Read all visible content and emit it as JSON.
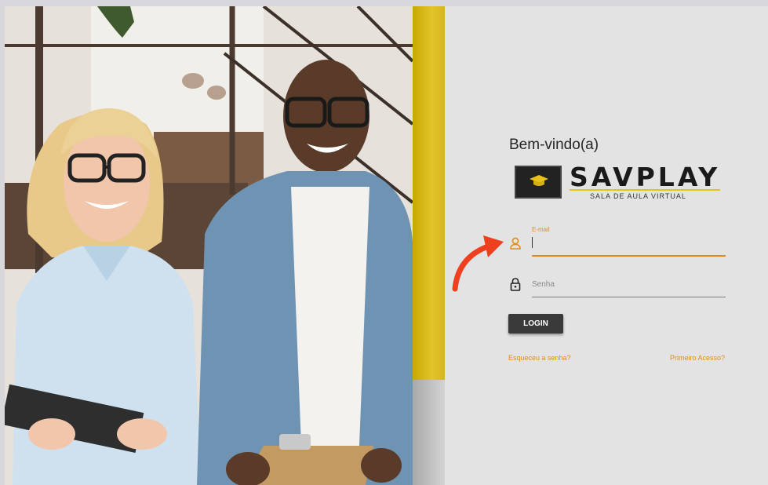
{
  "login": {
    "welcome_text": "Bem-vindo(a)",
    "logo": {
      "brand": "SAVPLAY",
      "tagline": "SALA DE AULA VIRTUAL"
    },
    "email": {
      "label": "E-mail",
      "value": ""
    },
    "password": {
      "placeholder": "Senha",
      "value": ""
    },
    "login_button": "LOGIN",
    "forgot_password_link": "Esqueceu a senha?",
    "first_access_link": "Primeiro Acesso?"
  },
  "icons": {
    "email_field": "user-icon",
    "password_field": "lock-icon",
    "annotation": "curved-arrow-icon"
  },
  "colors": {
    "accent": "#e08c1a",
    "yellow_bar": "#dcbf23",
    "button": "#3a3a3a",
    "panel_bg": "#e3e3e3",
    "annotation_arrow": "#ee3f1e"
  }
}
